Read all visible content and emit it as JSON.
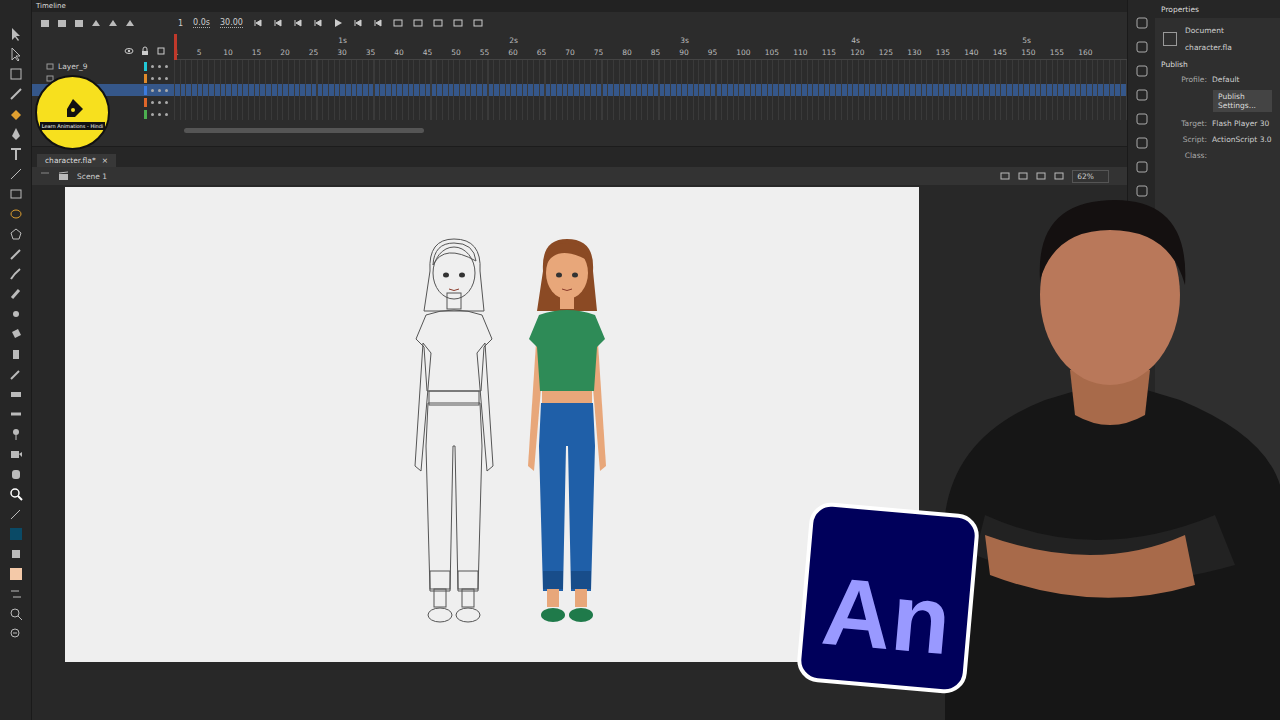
{
  "timeline": {
    "title": "Timeline",
    "current_frame": "1",
    "time": "0.0s",
    "fps": "30.00",
    "frames": [
      "1",
      "5",
      "10",
      "15",
      "20",
      "25",
      "30",
      "35",
      "40",
      "45",
      "50",
      "55",
      "60",
      "65",
      "70",
      "75",
      "80",
      "85",
      "90",
      "95",
      "100",
      "105",
      "110",
      "115",
      "120",
      "125",
      "130",
      "135",
      "140",
      "145",
      "150",
      "155",
      "160"
    ],
    "seconds": [
      "1s",
      "2s",
      "3s",
      "4s",
      "5s"
    ],
    "layers": [
      {
        "name": "Layer_9",
        "selected": false,
        "color": "#22c7d6"
      },
      {
        "name": "",
        "selected": false,
        "color": "#e08a2a"
      },
      {
        "name": "",
        "selected": true,
        "color": "#3b7be0"
      },
      {
        "name": "",
        "selected": false,
        "color": "#e0662a"
      },
      {
        "name": "",
        "selected": false,
        "color": "#4caf50"
      }
    ]
  },
  "document": {
    "tab": "character.fla*",
    "close": "×",
    "scene": "Scene 1",
    "zoom": "62%"
  },
  "properties": {
    "title": "Properties",
    "kind": "Document",
    "file": "character.fla",
    "section": "Publish",
    "rows": [
      {
        "label": "Profile:",
        "value": "Default"
      },
      {
        "label": "Target:",
        "value": "Flash Player 30"
      },
      {
        "label": "Script:",
        "value": "ActionScript 3.0"
      },
      {
        "label": "Class:",
        "value": ""
      }
    ],
    "button": "Publish Settings..."
  },
  "badge": {
    "text": "Learn Animations - Hindi"
  },
  "logo": {
    "text": "An"
  }
}
